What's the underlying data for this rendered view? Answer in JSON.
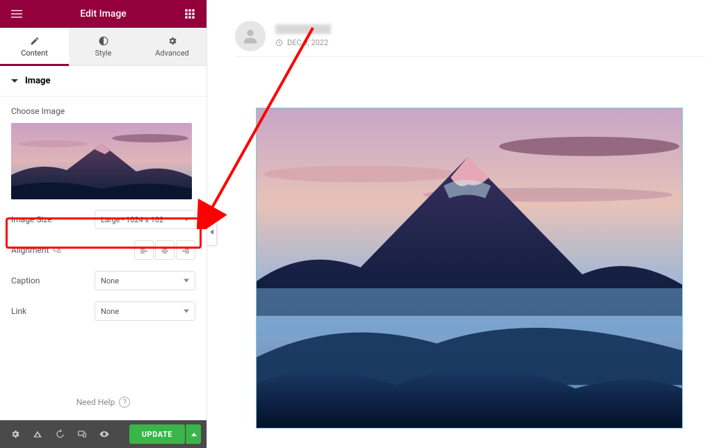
{
  "header": {
    "title": "Edit Image"
  },
  "tabs": {
    "content": "Content",
    "style": "Style",
    "advanced": "Advanced"
  },
  "section": {
    "title": "Image"
  },
  "fields": {
    "choose_label": "Choose Image",
    "image_size_label": "Image Size",
    "image_size_value": "Large - 1024 x 102",
    "alignment_label": "Alignment",
    "caption_label": "Caption",
    "caption_value": "None",
    "link_label": "Link",
    "link_value": "None"
  },
  "footer": {
    "help": "Need Help",
    "update": "UPDATE"
  },
  "post": {
    "date": "DEC 9, 2022"
  }
}
